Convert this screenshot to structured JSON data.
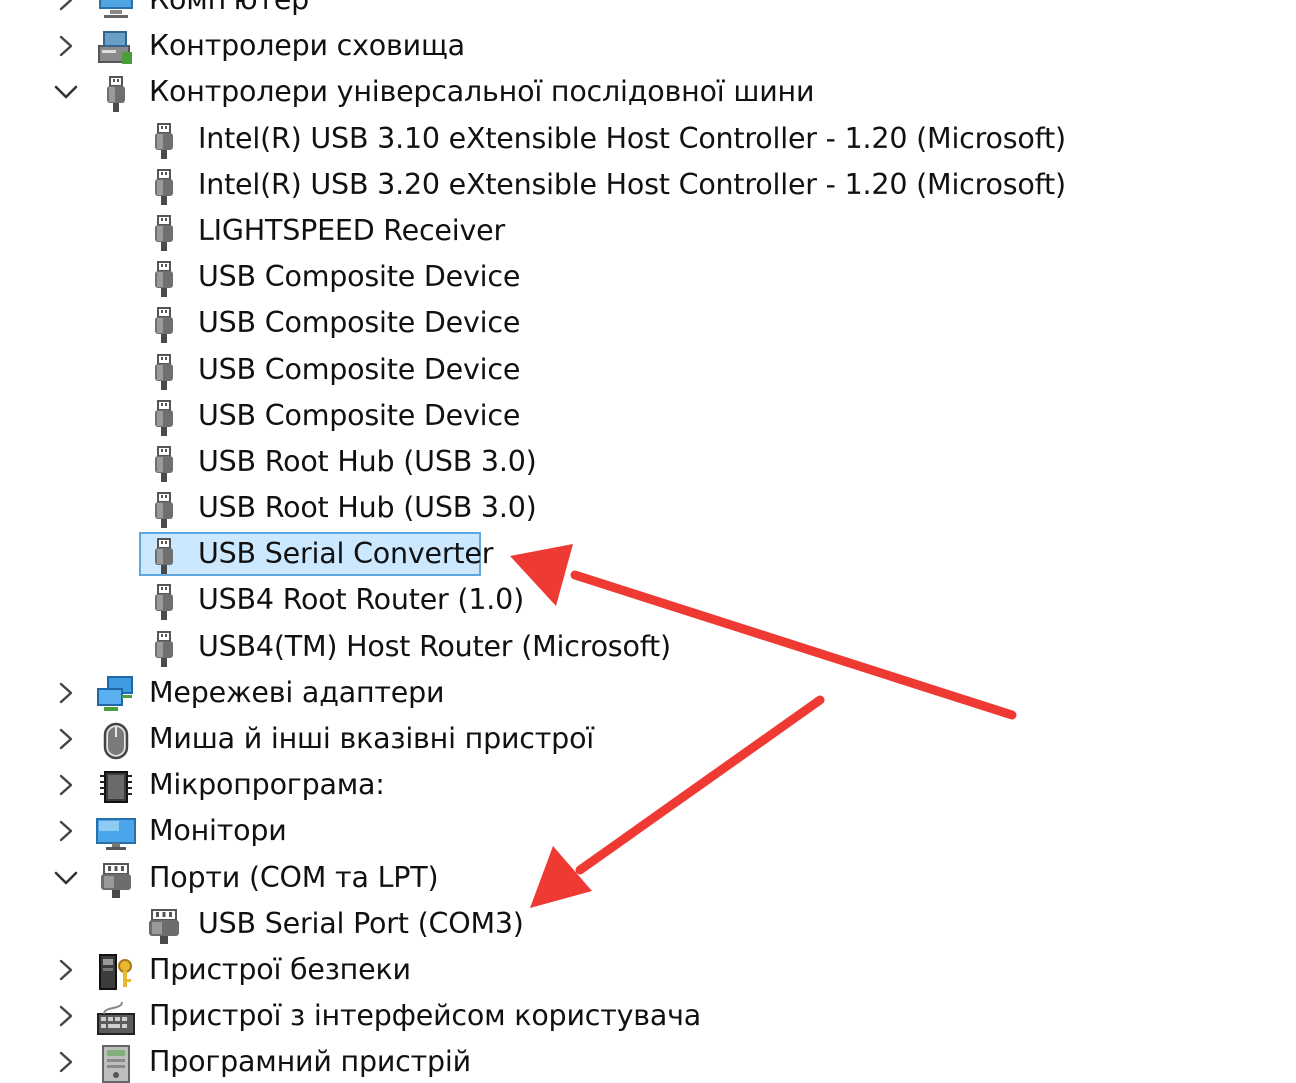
{
  "tree": {
    "rows": [
      {
        "label": "Комп'ютер",
        "level": 0,
        "state": "collapsed",
        "icon": "computer-icon"
      },
      {
        "label": "Контролери сховища",
        "level": 0,
        "state": "collapsed",
        "icon": "storage-controller-icon"
      },
      {
        "label": "Контролери універсальної послідовної шини",
        "level": 0,
        "state": "expanded",
        "icon": "usb-plug-icon"
      },
      {
        "label": "Intel(R) USB 3.10 eXtensible Host Controller - 1.20 (Microsoft)",
        "level": 1,
        "icon": "usb-plug-icon"
      },
      {
        "label": "Intel(R) USB 3.20 eXtensible Host Controller - 1.20 (Microsoft)",
        "level": 1,
        "icon": "usb-plug-icon"
      },
      {
        "label": "LIGHTSPEED Receiver",
        "level": 1,
        "icon": "usb-plug-icon"
      },
      {
        "label": "USB Composite Device",
        "level": 1,
        "icon": "usb-plug-icon"
      },
      {
        "label": "USB Composite Device",
        "level": 1,
        "icon": "usb-plug-icon"
      },
      {
        "label": "USB Composite Device",
        "level": 1,
        "icon": "usb-plug-icon"
      },
      {
        "label": "USB Composite Device",
        "level": 1,
        "icon": "usb-plug-icon"
      },
      {
        "label": "USB Root Hub (USB 3.0)",
        "level": 1,
        "icon": "usb-plug-icon"
      },
      {
        "label": "USB Root Hub (USB 3.0)",
        "level": 1,
        "icon": "usb-plug-icon"
      },
      {
        "label": "USB Serial Converter",
        "level": 1,
        "icon": "usb-plug-icon",
        "selected": true
      },
      {
        "label": "USB4 Root Router (1.0)",
        "level": 1,
        "icon": "usb-plug-icon"
      },
      {
        "label": "USB4(TM) Host Router (Microsoft)",
        "level": 1,
        "icon": "usb-plug-icon"
      },
      {
        "label": "Мережеві адаптери",
        "level": 0,
        "state": "collapsed",
        "icon": "network-adapter-icon"
      },
      {
        "label": "Миша й інші вказівні пристрої",
        "level": 0,
        "state": "collapsed",
        "icon": "mouse-icon"
      },
      {
        "label": "Мікропрограма:",
        "level": 0,
        "state": "collapsed",
        "icon": "firmware-chip-icon"
      },
      {
        "label": "Монітори",
        "level": 0,
        "state": "collapsed",
        "icon": "monitor-icon"
      },
      {
        "label": "Порти (COM та LPT)",
        "level": 0,
        "state": "expanded",
        "icon": "port-icon"
      },
      {
        "label": "USB Serial Port (COM3)",
        "level": 1,
        "icon": "port-icon"
      },
      {
        "label": "Пристрої безпеки",
        "level": 0,
        "state": "collapsed",
        "icon": "security-device-icon"
      },
      {
        "label": "Пристрої з інтерфейсом користувача",
        "level": 0,
        "state": "collapsed",
        "icon": "hid-keyboard-icon"
      },
      {
        "label": "Програмний пристрій",
        "level": 0,
        "state": "collapsed",
        "icon": "software-device-icon"
      }
    ]
  },
  "colors": {
    "selection_fill": "#cce8ff",
    "selection_border": "#5fa7e0",
    "annotation_arrow": "#ee3a33"
  }
}
